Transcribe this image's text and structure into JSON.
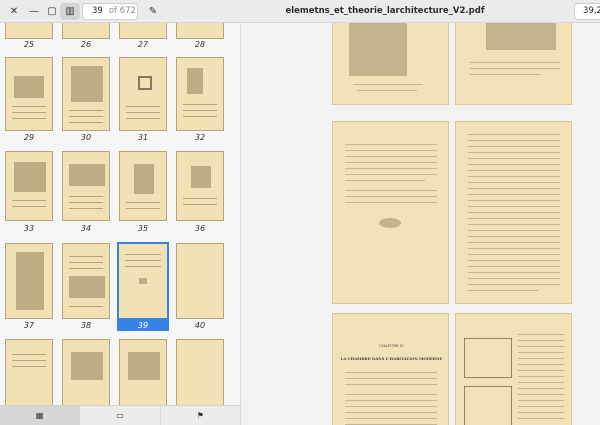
{
  "header": {
    "current_page": "39",
    "page_of": "of 672",
    "title": "elemetns_et_theorie_larchitecture_V2.pdf",
    "zoom": "39,2%"
  },
  "icons": {
    "window": [
      "close-icon",
      "minimize-icon",
      "maximize-icon"
    ],
    "sidebar_toggle": "sidebar-icon",
    "edit": "pencil-icon"
  },
  "thumbnails": {
    "rows": [
      [
        "25",
        "26",
        "27",
        "28"
      ],
      [
        "29",
        "30",
        "31",
        "32"
      ],
      [
        "33",
        "34",
        "35",
        "36"
      ],
      [
        "37",
        "38",
        "39",
        "40"
      ]
    ],
    "selected": "39"
  },
  "tabs": [
    "grid-icon",
    "annotations-icon",
    "bookmark-icon"
  ],
  "main": {
    "page_heading": "CHAPITRE IV",
    "page_subheading": "LA CHAMBRE DANS L'HABITATION MODERNE"
  }
}
